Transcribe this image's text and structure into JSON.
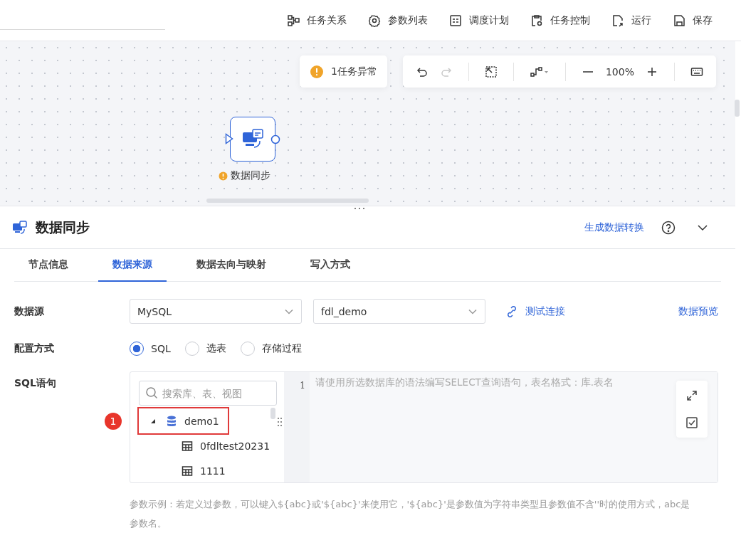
{
  "toolbar": [
    {
      "kind": "relation",
      "label": "任务关系"
    },
    {
      "kind": "params",
      "label": "参数列表"
    },
    {
      "kind": "schedule",
      "label": "调度计划"
    },
    {
      "kind": "control",
      "label": "任务控制"
    },
    {
      "kind": "run",
      "label": "运行"
    },
    {
      "kind": "save",
      "label": "保存"
    }
  ],
  "canvas": {
    "alert": "1任务异常",
    "history": [
      {
        "kind": "undo",
        "disabled": false
      },
      {
        "kind": "redo",
        "disabled": true
      }
    ],
    "zoom": "100%",
    "node": {
      "label": "数据同步",
      "warning": true
    }
  },
  "panel": {
    "title": "数据同步",
    "link": "生成数据转换",
    "tabs": [
      {
        "label": "节点信息",
        "selected": false
      },
      {
        "label": "数据来源",
        "selected": true
      },
      {
        "label": "数据去向与映射",
        "selected": false
      },
      {
        "label": "写入方式",
        "selected": false
      }
    ],
    "datasource_label": "数据源",
    "datasource_type": "MySQL",
    "datasource_name": "fdl_demo",
    "test_link": "测试连接",
    "preview_link": "数据预览",
    "config_label": "配置方式",
    "config_options": [
      {
        "label": "SQL",
        "selected": true
      },
      {
        "label": "选表",
        "selected": false
      },
      {
        "label": "存储过程",
        "selected": false
      }
    ],
    "sql_label": "SQL语句",
    "search_placeholder": "搜索库、表、视图",
    "tree": [
      {
        "label": "demo1",
        "expanded": true,
        "highlighted": true,
        "children": [
          {
            "label": "0fdltest20231"
          },
          {
            "label": "1111"
          }
        ]
      }
    ],
    "marker": "1",
    "line_number": "1",
    "editor_placeholder": "请使用所选数据库的语法编写SELECT查询语句，表名格式：库.表名",
    "hint": "参数示例：若定义过参数，可以键入${abc}或'${abc}'来使用它，'${abc}'是参数值为字符串类型且参数值不含''时的使用方式，abc是参数名。"
  }
}
